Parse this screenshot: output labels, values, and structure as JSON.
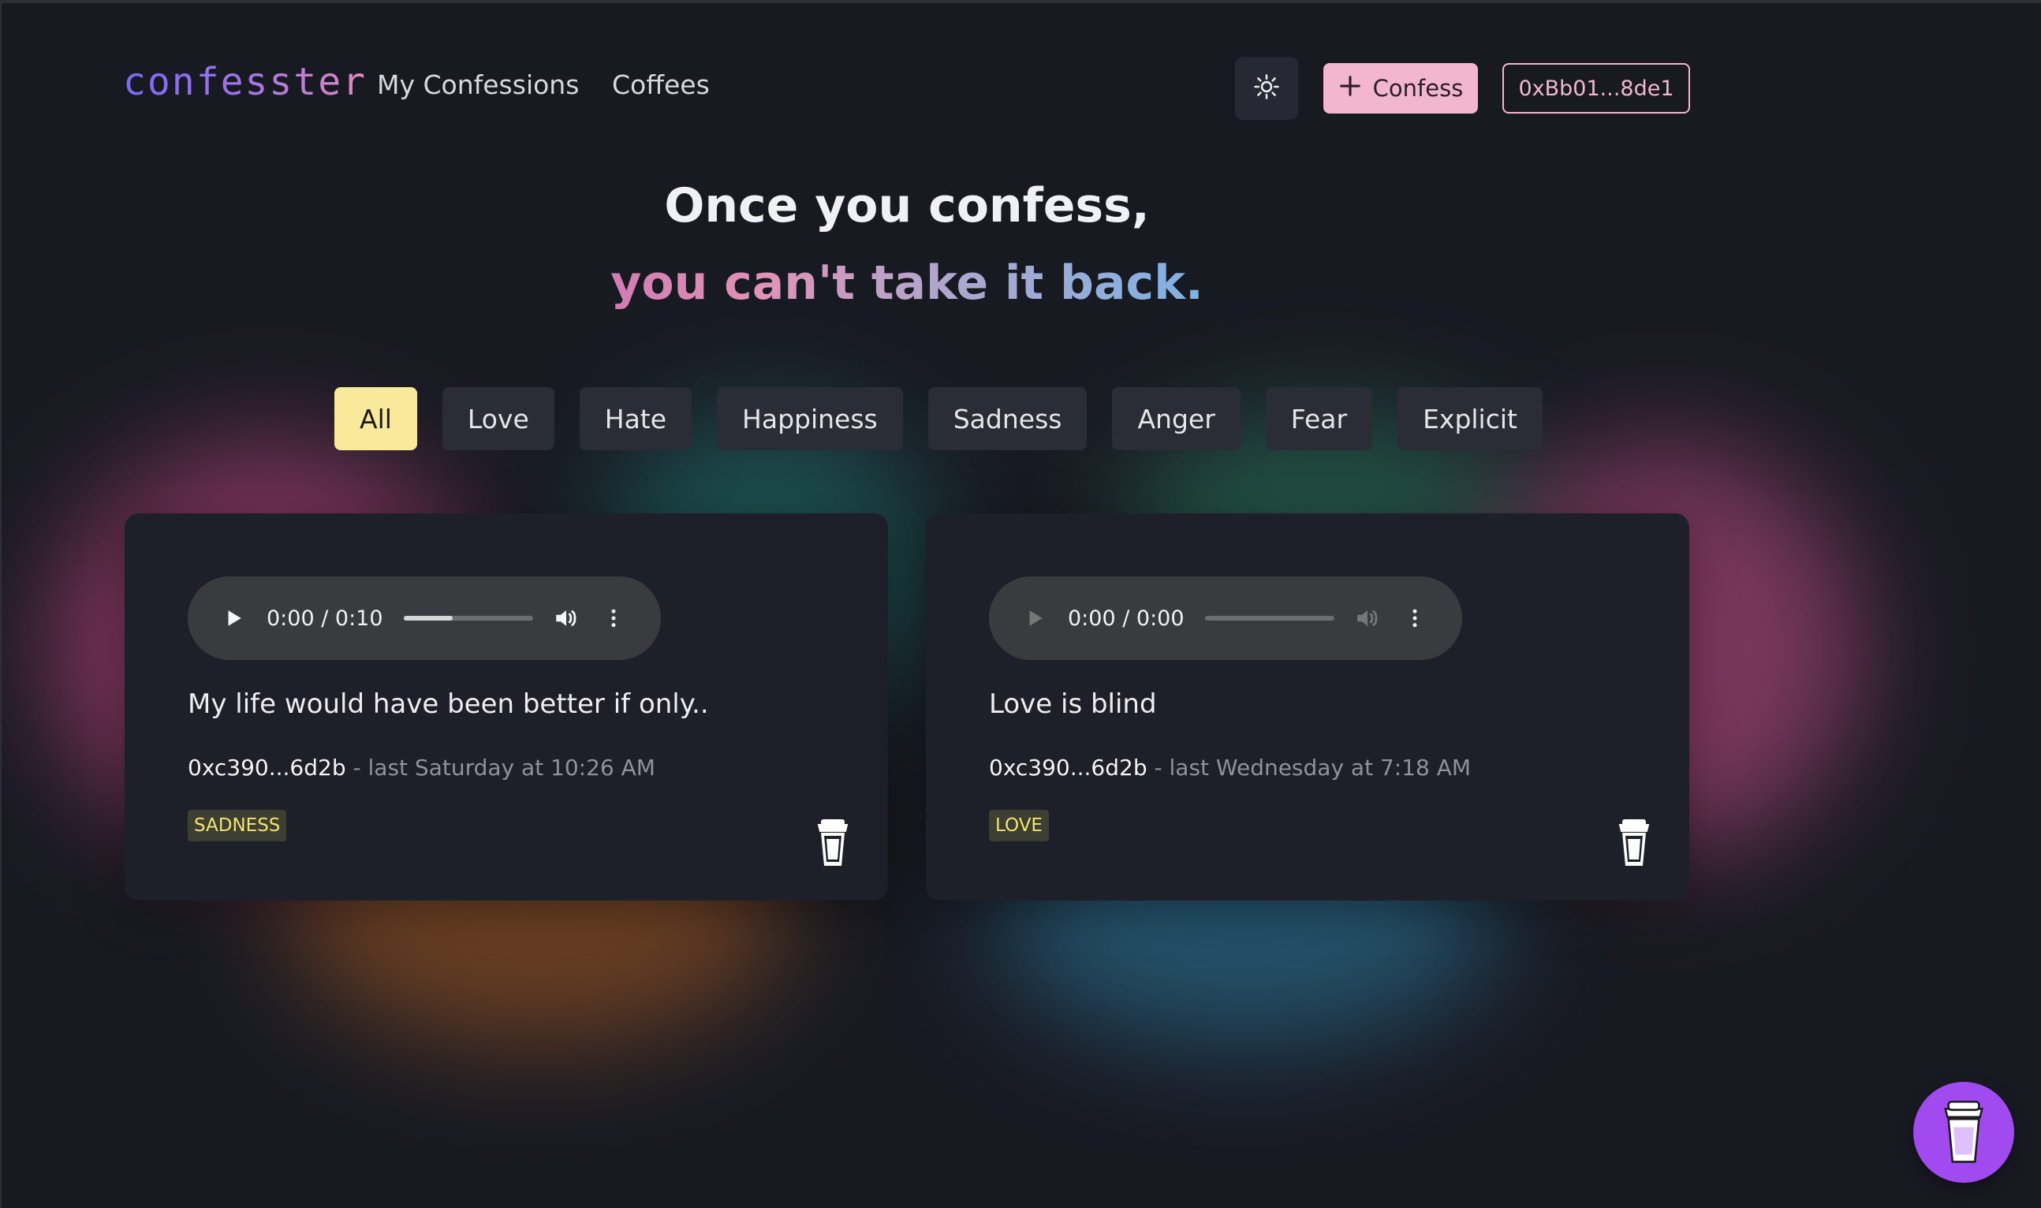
{
  "header": {
    "logo": "confesster",
    "nav": [
      "My Confessions",
      "Coffees"
    ],
    "confess_label": "Confess",
    "wallet": "0xBb01...8de1"
  },
  "hero": {
    "line1": "Once you confess,",
    "line2": "you can't take it back."
  },
  "filters": [
    "All",
    "Love",
    "Hate",
    "Happiness",
    "Sadness",
    "Anger",
    "Fear",
    "Explicit"
  ],
  "cards": [
    {
      "audio_time": "0:00 / 0:10",
      "progress": 0.38,
      "text": "My life would have been better if only..",
      "author": "0xc390...6d2b",
      "time_text": " - last Saturday at 10:26 AM",
      "tag": "SADNESS"
    },
    {
      "audio_time": "0:00 / 0:00",
      "progress": 0,
      "text": "Love is blind",
      "author": "0xc390...6d2b",
      "time_text": " - last Wednesday at 7:18 AM",
      "tag": "LOVE"
    }
  ],
  "colors": {
    "accent_pink": "#f2b7cf",
    "accent_yellow": "#f8e99b",
    "fab_purple": "#a14af0",
    "background": "#181a22"
  },
  "icons": {
    "theme": "sun-icon",
    "confess": "plus-icon",
    "play": "play-icon",
    "volume": "volume-icon",
    "more": "more-icon",
    "coffee": "coffee-cup-icon"
  }
}
